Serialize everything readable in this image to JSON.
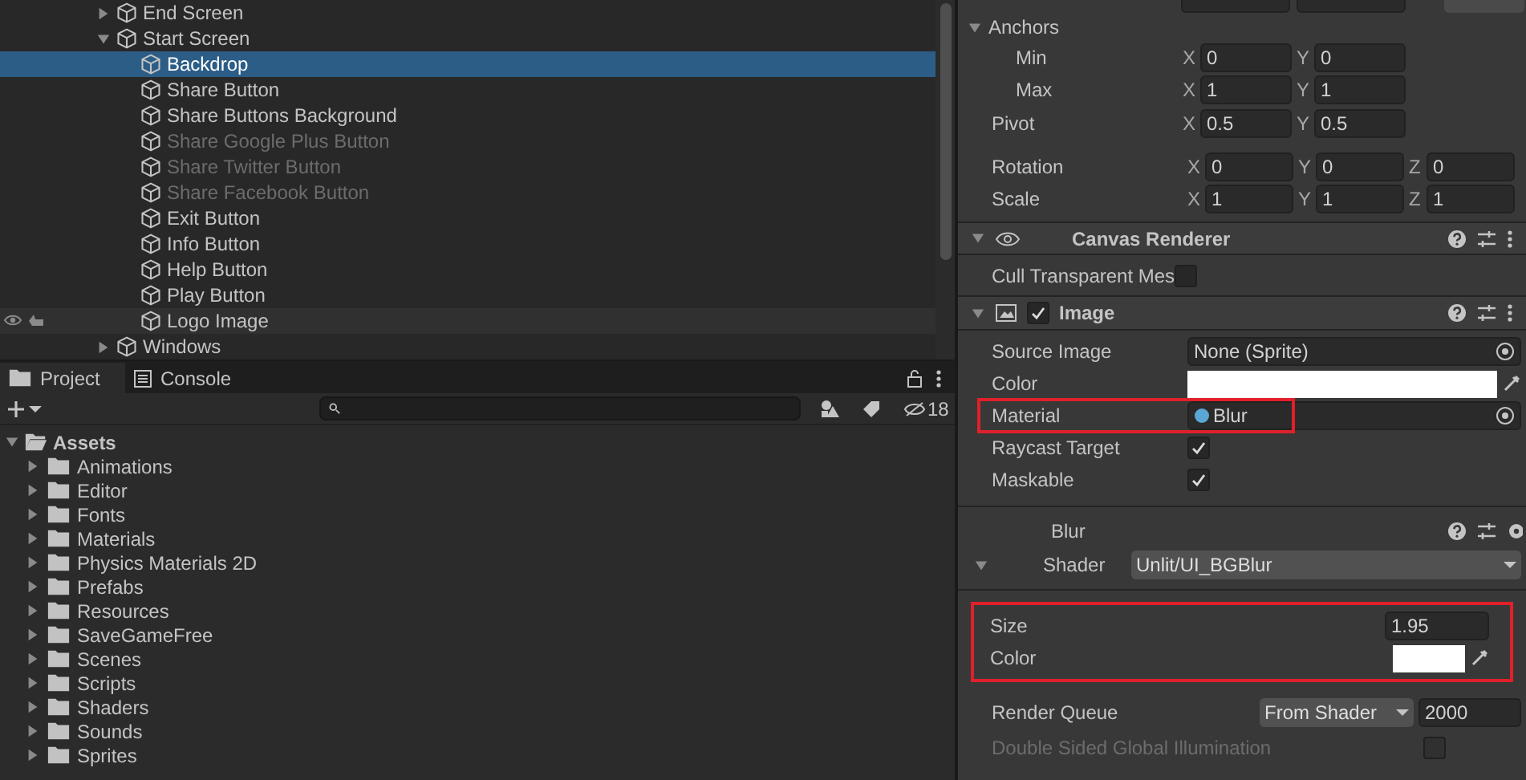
{
  "hierarchy": {
    "items": [
      {
        "label": "End Screen",
        "expanded": false
      },
      {
        "label": "Start Screen",
        "expanded": true,
        "children": [
          {
            "label": "Backdrop",
            "selected": true,
            "disabled": false,
            "hovered": false
          },
          {
            "label": "Share Button",
            "selected": false,
            "disabled": false,
            "hovered": false
          },
          {
            "label": "Share Buttons Background",
            "selected": false,
            "disabled": false,
            "hovered": false
          },
          {
            "label": "Share Google Plus Button",
            "selected": false,
            "disabled": true,
            "hovered": false
          },
          {
            "label": "Share Twitter Button",
            "selected": false,
            "disabled": true,
            "hovered": false
          },
          {
            "label": "Share Facebook Button",
            "selected": false,
            "disabled": true,
            "hovered": false
          },
          {
            "label": "Exit Button",
            "selected": false,
            "disabled": false,
            "hovered": false
          },
          {
            "label": "Info Button",
            "selected": false,
            "disabled": false,
            "hovered": false
          },
          {
            "label": "Help Button",
            "selected": false,
            "disabled": false,
            "hovered": false
          },
          {
            "label": "Play Button",
            "selected": false,
            "disabled": false,
            "hovered": false
          },
          {
            "label": "Logo Image",
            "selected": false,
            "disabled": false,
            "hovered": true
          }
        ]
      },
      {
        "label": "Windows",
        "expanded": false
      }
    ]
  },
  "project": {
    "tabs": [
      {
        "label": "Project",
        "selected": true
      },
      {
        "label": "Console",
        "selected": false
      }
    ],
    "hidden_count": "18",
    "root": {
      "label": "Assets",
      "expanded": true,
      "children": [
        "Animations",
        "Editor",
        "Fonts",
        "Materials",
        "Physics Materials 2D",
        "Prefabs",
        "Resources",
        "SaveGameFree",
        "Scenes",
        "Scripts",
        "Shaders",
        "Sounds",
        "Sprites"
      ]
    }
  },
  "inspector": {
    "anchors": {
      "label": "Anchors",
      "expanded": true,
      "rows": [
        {
          "label": "Min",
          "values": [
            {
              "axis": "X",
              "value": "0"
            },
            {
              "axis": "Y",
              "value": "0"
            }
          ]
        },
        {
          "label": "Max",
          "values": [
            {
              "axis": "X",
              "value": "1"
            },
            {
              "axis": "Y",
              "value": "1"
            }
          ]
        }
      ]
    },
    "pivot": {
      "label": "Pivot",
      "values": [
        {
          "axis": "X",
          "value": "0.5"
        },
        {
          "axis": "Y",
          "value": "0.5"
        }
      ]
    },
    "transform_rows": [
      {
        "label": "Rotation",
        "values": [
          {
            "axis": "X",
            "value": "0"
          },
          {
            "axis": "Y",
            "value": "0"
          },
          {
            "axis": "Z",
            "value": "0"
          }
        ]
      },
      {
        "label": "Scale",
        "values": [
          {
            "axis": "X",
            "value": "1"
          },
          {
            "axis": "Y",
            "value": "1"
          },
          {
            "axis": "Z",
            "value": "1"
          }
        ]
      }
    ],
    "canvas_renderer": {
      "title": "Canvas Renderer",
      "expanded": true,
      "cull_label": "Cull Transparent Mes",
      "cull_checked": false
    },
    "image": {
      "title": "Image",
      "expanded": true,
      "enabled": true,
      "source_image": {
        "label": "Source Image",
        "value": "None (Sprite)"
      },
      "color": {
        "label": "Color"
      },
      "material": {
        "label": "Material",
        "value": "Blur",
        "highlighted": true
      },
      "raycast": {
        "label": "Raycast Target",
        "checked": true
      },
      "maskable": {
        "label": "Maskable",
        "checked": true
      }
    },
    "material_section": {
      "name": "Blur",
      "shader_label": "Shader",
      "shader": "Unlit/UI_BGBlur",
      "properties_highlighted": true,
      "size": {
        "label": "Size",
        "value": "1.95"
      },
      "color": {
        "label": "Color"
      },
      "render_queue": {
        "label": "Render Queue",
        "mode": "From Shader",
        "value": "2000"
      },
      "double_sided": {
        "label": "Double Sided Global Illumination",
        "checked": false,
        "disabled": true
      }
    }
  }
}
